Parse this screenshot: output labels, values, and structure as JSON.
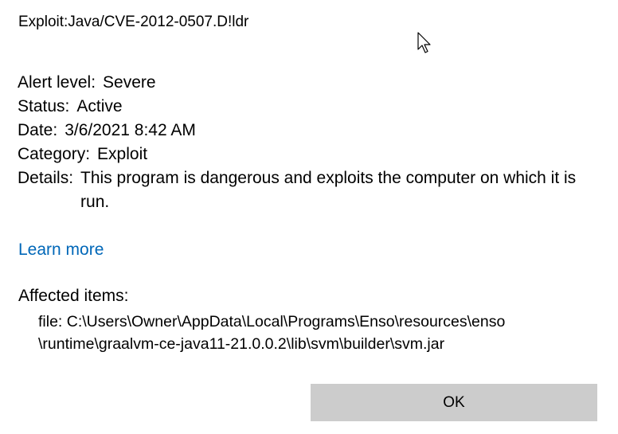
{
  "threat": {
    "name": "Exploit:Java/CVE-2012-0507.D!ldr"
  },
  "details": {
    "alert_level": {
      "label": "Alert level:",
      "value": "Severe"
    },
    "status": {
      "label": "Status:",
      "value": "Active"
    },
    "date": {
      "label": "Date:",
      "value": "3/6/2021 8:42 AM"
    },
    "category": {
      "label": "Category:",
      "value": "Exploit"
    },
    "description": {
      "label": "Details:",
      "value": "This program is dangerous and exploits the computer on which it is run."
    }
  },
  "learn_more": {
    "label": "Learn more"
  },
  "affected": {
    "heading": "Affected items:",
    "item_line1": "file: C:\\Users\\Owner\\AppData\\Local\\Programs\\Enso\\resources\\enso",
    "item_line2": "\\runtime\\graalvm-ce-java11-21.0.0.2\\lib\\svm\\builder\\svm.jar"
  },
  "actions": {
    "ok_label": "OK"
  },
  "colors": {
    "link": "#0067b8",
    "button_bg": "#cccccc",
    "background": "#ffffff"
  },
  "icons": {
    "cursor": "mouse-pointer-icon"
  }
}
